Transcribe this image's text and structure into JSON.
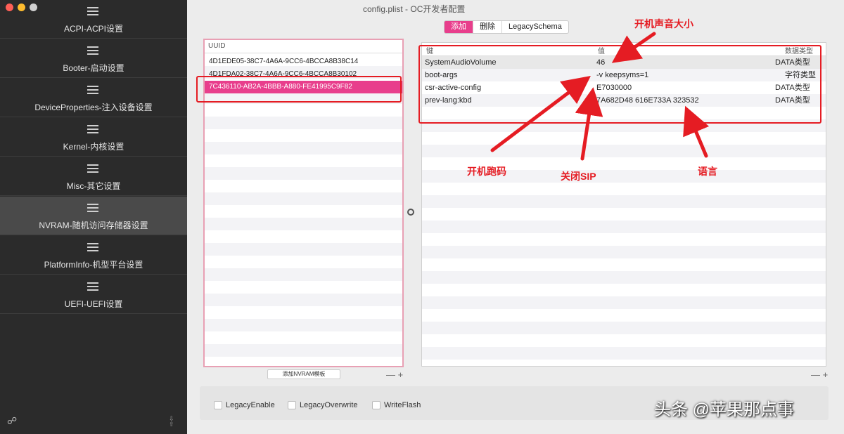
{
  "window": {
    "title": "config.plist - OC开发者配置",
    "traffic_lights": {
      "close": "#ff5f57",
      "minimize": "#febc2e",
      "zoom": "#d0d0d0"
    }
  },
  "sidebar": {
    "items": [
      {
        "label": "ACPI-ACPI设置",
        "icon": "list-icon"
      },
      {
        "label": "Booter-启动设置",
        "icon": "list-icon"
      },
      {
        "label": "DeviceProperties-注入设备设置",
        "icon": "list-icon"
      },
      {
        "label": "Kernel-内核设置",
        "icon": "list-icon"
      },
      {
        "label": "Misc-其它设置",
        "icon": "list-icon"
      },
      {
        "label": "NVRAM-随机访问存储器设置",
        "icon": "list-icon",
        "active": true
      },
      {
        "label": "PlatformInfo-机型平台设置",
        "icon": "list-icon"
      },
      {
        "label": "UEFI-UEFI设置",
        "icon": "list-icon"
      }
    ],
    "share_icon": "share-icon"
  },
  "tabs": [
    "添加",
    "删除",
    "LegacySchema"
  ],
  "uuid_panel": {
    "header": "UUID",
    "rows": [
      "4D1EDE05-38C7-4A6A-9CC6-4BCCA8B38C14",
      "4D1FDA02-38C7-4A6A-9CC6-4BCCA8B30102",
      "7C436110-AB2A-4BBB-A880-FE41995C9F82"
    ],
    "selected_index": 2,
    "button_label": "添加NVRAM模板"
  },
  "kv_panel": {
    "headers": [
      "键",
      "值",
      "数据类型"
    ],
    "rows": [
      {
        "key": "SystemAudioVolume",
        "value": "46",
        "type": "DATA类型"
      },
      {
        "key": "boot-args",
        "value": "-v keepsyms=1",
        "type": "字符类型"
      },
      {
        "key": "csr-active-config",
        "value": "E7030000",
        "type": "DATA类型"
      },
      {
        "key": "prev-lang:kbd",
        "value": "7A682D48 616E733A 323532",
        "type": "DATA类型"
      }
    ]
  },
  "plus_minus": "— +",
  "checkboxes": [
    "LegacyEnable",
    "LegacyOverwrite",
    "WriteFlash"
  ],
  "annotations": {
    "volume": "开机声音大小",
    "bootargs": "开机跑码",
    "sip": "关闭SIP",
    "lang": "语言",
    "color": "#e51c23"
  },
  "watermark": "头条 @苹果那点事"
}
